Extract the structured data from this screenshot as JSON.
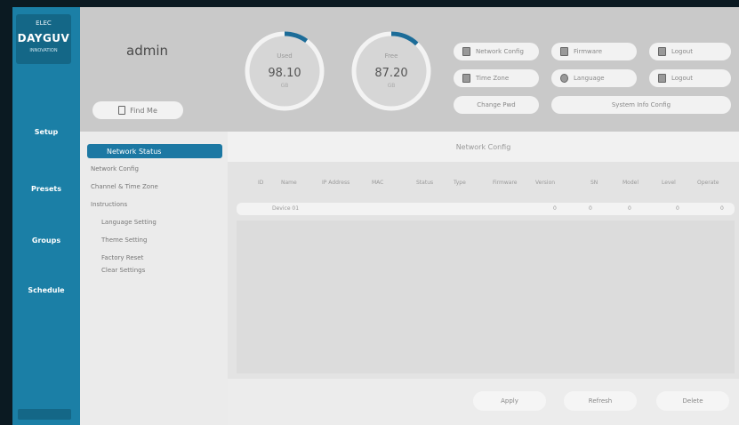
{
  "logo": {
    "top": "ELEC",
    "brand": "DAYGUV",
    "sub": "INNOVATION"
  },
  "sidebar": {
    "items": [
      {
        "label": "Setup"
      },
      {
        "label": "Presets"
      },
      {
        "label": "Groups"
      },
      {
        "label": "Schedule"
      }
    ]
  },
  "header": {
    "user": "admin",
    "find_me": "Find Me",
    "gauges": [
      {
        "top": "Used",
        "value": "98.10",
        "sub": "GB",
        "fraction": 0.1
      },
      {
        "top": "Free",
        "value": "87.20",
        "sub": "GB",
        "fraction": 0.12
      }
    ],
    "buttons": [
      "Network Config",
      "Time Zone",
      "Change Pwd",
      "Firmware",
      "Language",
      "Logout"
    ],
    "wide_button": "System Info Config"
  },
  "submenu": {
    "active": "Network Status",
    "items": [
      "Network Config",
      "Channel & Time Zone",
      "Instructions",
      "Language Setting",
      "Theme Setting",
      "Factory Reset",
      "Clear Settings"
    ]
  },
  "content": {
    "title": "Network Config",
    "columns": [
      "ID",
      "Name",
      "IP Address",
      "MAC",
      "Status",
      "Type",
      "Firmware",
      "Version",
      "SN",
      "Model",
      "Level",
      "Operate"
    ],
    "row": {
      "name": "Device 01",
      "cells": [
        "0",
        "0",
        "0",
        "0",
        "0"
      ]
    },
    "footer_buttons": [
      "Apply",
      "Refresh",
      "Delete"
    ]
  }
}
